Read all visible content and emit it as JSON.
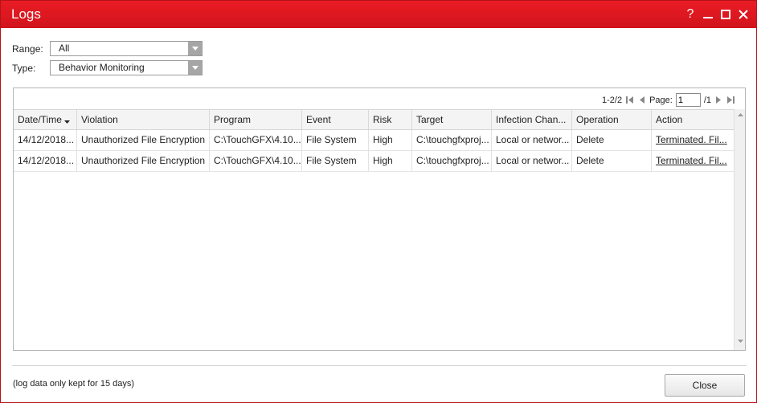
{
  "window": {
    "title": "Logs",
    "controls": [
      "?",
      "minimize",
      "maximize",
      "close"
    ]
  },
  "filters": {
    "range_label": "Range:",
    "range_value": "All",
    "type_label": "Type:",
    "type_value": "Behavior Monitoring"
  },
  "pager": {
    "count": "1-2/2",
    "page_label": "Page:",
    "page_value": "1",
    "page_total": "/1"
  },
  "table": {
    "sorted_column": "Date/Time",
    "columns": [
      "Date/Time",
      "Violation",
      "Program",
      "Event",
      "Risk",
      "Target",
      "Infection Chan...",
      "Operation",
      "Action"
    ],
    "rows": [
      [
        "14/12/2018...",
        "Unauthorized File Encryption",
        "C:\\TouchGFX\\4.10...",
        "File System",
        "High",
        "C:\\touchgfxproj...",
        "Local or networ...",
        "Delete",
        "Terminated. Fil..."
      ],
      [
        "14/12/2018...",
        "Unauthorized File Encryption",
        "C:\\TouchGFX\\4.10...",
        "File System",
        "High",
        "C:\\touchgfxproj...",
        "Local or networ...",
        "Delete",
        "Terminated. Fil..."
      ]
    ]
  },
  "footer": {
    "note": "(log data only kept for 15 days)",
    "close_label": "Close"
  },
  "colors": {
    "titlebar": "#e01820",
    "header_bg": "#f4f4f4",
    "border": "#b5b5b5"
  }
}
